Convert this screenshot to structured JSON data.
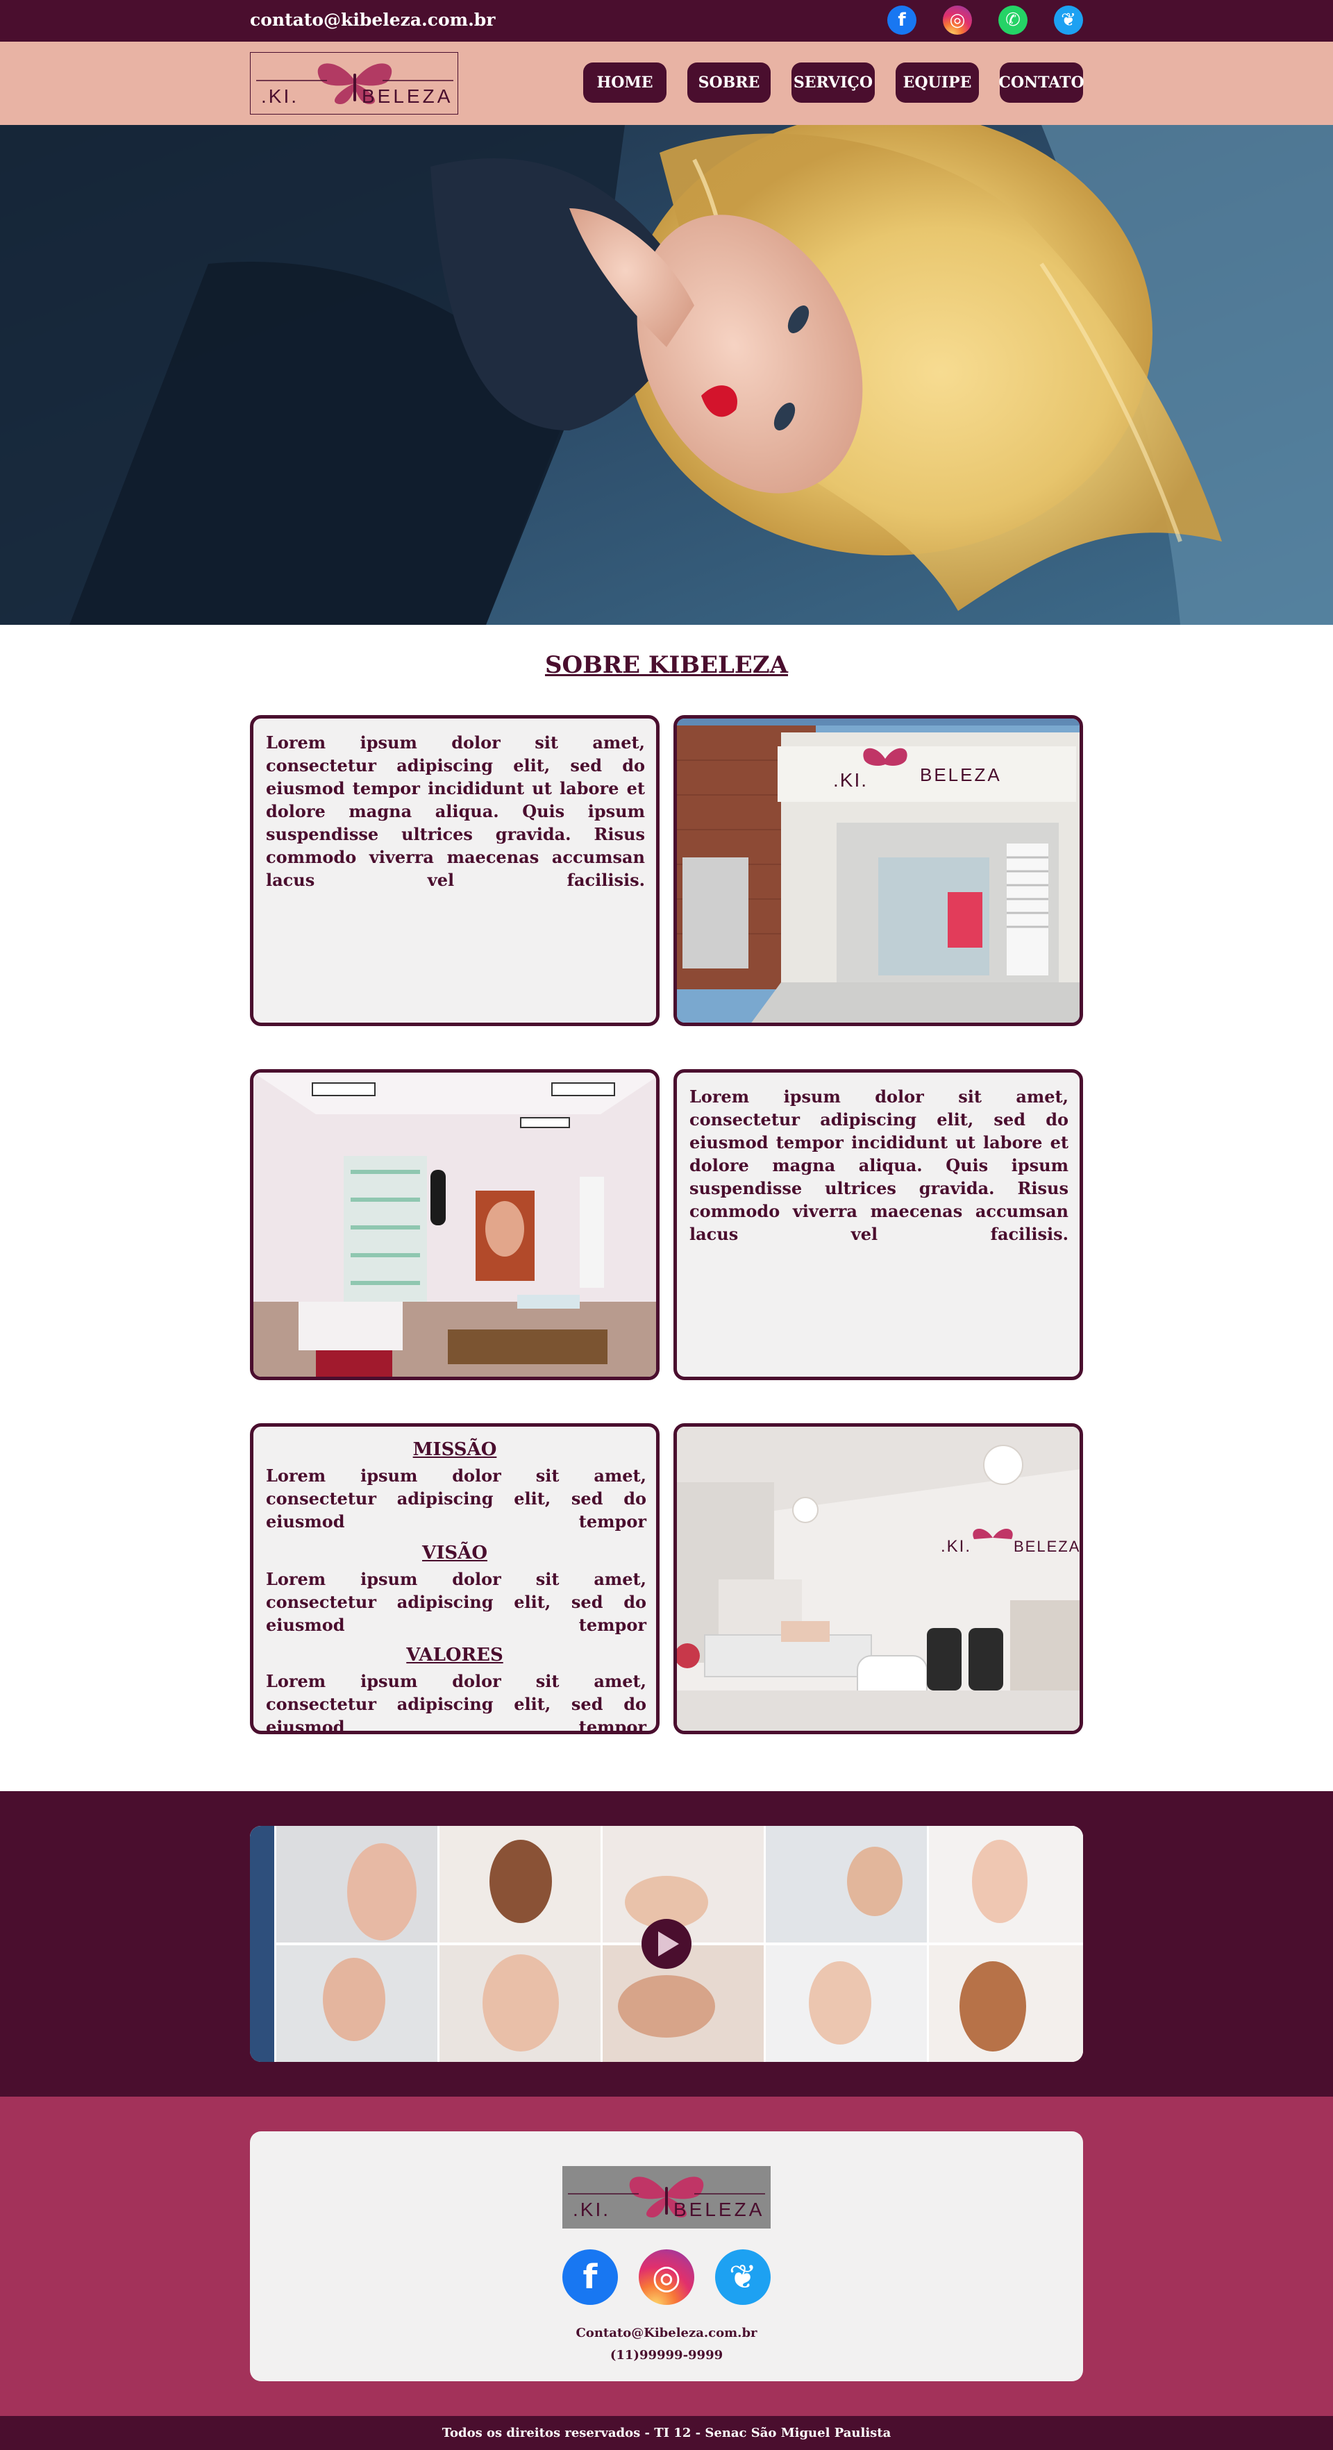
{
  "topbar": {
    "email": "contato@kibeleza.com.br",
    "social": [
      {
        "icon": "facebook-icon",
        "glyph": "f"
      },
      {
        "icon": "instagram-icon",
        "glyph": "◎"
      },
      {
        "icon": "whatsapp-icon",
        "glyph": "✆"
      },
      {
        "icon": "twitter-icon",
        "glyph": "❦"
      }
    ]
  },
  "brand": {
    "prefix": ".KI.",
    "name": "BELEZA",
    "logo_icon": "butterfly-icon"
  },
  "nav": {
    "items": [
      "HOME",
      "SOBRE",
      "SERVIÇO",
      "EQUIPE",
      "CONTATO"
    ]
  },
  "hero": {
    "image": "woman-lying-blonde-hair-photo"
  },
  "about": {
    "title": "SOBRE KIBELEZA",
    "paragraph_1": "Lorem ipsum dolor sit amet, consectetur adipiscing elit, sed do eiusmod tempor incididunt ut labore et dolore magna aliqua. Quis ipsum suspendisse ultrices gravida. Risus commodo viverra maecenas accumsan lacus vel facilisis.",
    "paragraph_2": "Lorem ipsum dolor sit amet, consectetur adipiscing elit, sed do eiusmod tempor incididunt ut labore et dolore magna aliqua. Quis ipsum suspendisse ultrices gravida. Risus commodo viverra maecenas accumsan lacus vel facilisis.",
    "images": [
      "salon-facade-photo",
      "salon-interior-photo",
      "salon-reception-photo"
    ],
    "mission_title": "MISSÃO",
    "mission_text": "Lorem ipsum dolor sit amet, consectetur adipiscing elit, sed do eiusmod tempor",
    "vision_title": "VISÃO",
    "vision_text": "Lorem ipsum dolor sit amet, consectetur adipiscing elit, sed do eiusmod tempor",
    "values_title": "VALORES",
    "values_text": "Lorem ipsum dolor sit amet, consectetur adipiscing elit, sed do eiusmod tempor"
  },
  "video": {
    "play_icon": "play-icon",
    "thumbnails": "beauty-treatments-collage"
  },
  "footer": {
    "social": [
      {
        "icon": "facebook-icon",
        "glyph": "f"
      },
      {
        "icon": "instagram-icon",
        "glyph": "◎"
      },
      {
        "icon": "twitter-icon",
        "glyph": "❦"
      }
    ],
    "email": "Contato@Kibeleza.com.br",
    "phone": "(11)99999-9999",
    "copyright": "Todos os direitos reservados - TI 12 - Senac São Miguel Paulista"
  },
  "colors": {
    "plum": "#4a0e2e",
    "rose": "#e8b3a4",
    "berry": "#a3325a",
    "card": "#f2f1f1"
  }
}
